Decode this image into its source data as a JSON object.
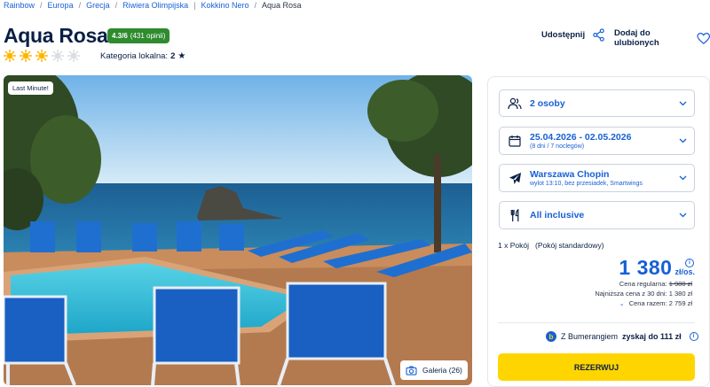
{
  "breadcrumb": [
    "Rainbow",
    "Europa",
    "Grecja",
    "Riwiera Olimpijska",
    "Kokkino Nero",
    "Aqua Rosa"
  ],
  "hotel": {
    "name": "Aqua Rosa",
    "rating_score": "4.3/6",
    "rating_count": "(431 opinii)",
    "stars_filled": 3,
    "stars_total": 5,
    "local_category_label": "Kategoria lokalna:",
    "local_category_value": "2"
  },
  "actions": {
    "share_label": "Udostępnij",
    "favorite_label": "Dodaj do ulubionych"
  },
  "photo": {
    "badge": "Last Minute!",
    "gallery_label": "Galeria (26)"
  },
  "booking": {
    "persons": "2 osoby",
    "dates": "25.04.2026 - 02.05.2026",
    "dates_sub": "(8 dni / 7 noclegów)",
    "departure": "Warszawa Chopin",
    "departure_sub": "wylot 13:10, bez przesiadek, Smartwings",
    "board": "All inclusive",
    "room": "1 x Pokój   (Pokój standardowy)",
    "price": "1 380",
    "price_unit": "zł/os.",
    "regular_label": "Cena regularna:",
    "regular_price": "1 980 zł",
    "lowest_30": "Najniższa cena z 30 dni: 1 380 zł",
    "total": "Cena razem: 2 759 zł",
    "bumerang_text": "Z Bumerangiem",
    "bumerang_bold": "zyskaj do 111 zł",
    "book_button": "REZERWUJ"
  },
  "colors": {
    "brand_blue": "#1760d5",
    "rating_green": "#2e8b2e",
    "cta_yellow": "#ffd500",
    "star_filled": "#ffb400",
    "star_empty": "#d9dce2"
  },
  "icons": [
    "sun-star-icon",
    "star-icon",
    "share-icon",
    "heart-icon",
    "camera-icon",
    "persons-icon",
    "calendar-icon",
    "plane-icon",
    "cutlery-icon",
    "chevron-down-icon",
    "info-icon",
    "bumerang-icon"
  ]
}
